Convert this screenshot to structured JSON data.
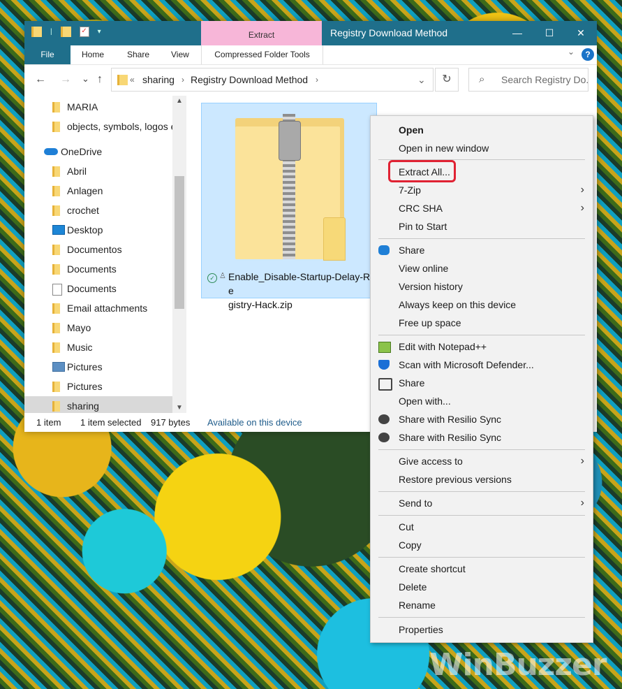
{
  "window": {
    "title": "Registry Download Method",
    "context_tab_top": "Extract",
    "controls": {
      "minimize": "—",
      "maximize": "☐",
      "close": "✕"
    }
  },
  "ribbon": {
    "tabs": [
      "File",
      "Home",
      "Share",
      "View"
    ],
    "context_tab": "Compressed Folder Tools",
    "help": "?"
  },
  "nav": {
    "back": "←",
    "forward": "→",
    "recent": "⌄",
    "up": "↑"
  },
  "address": {
    "overflow": "«",
    "crumbs": [
      "sharing",
      "Registry Download Method"
    ],
    "sep": "›",
    "dropdown": "⌄",
    "refresh": "↻"
  },
  "search": {
    "placeholder": "Search Registry Do...",
    "icon": "⌕"
  },
  "navpane": {
    "items": [
      {
        "label": "MARIA",
        "icon": "folder-icon"
      },
      {
        "label": "objects, symbols, logos e",
        "icon": "folder-icon"
      },
      {
        "label": "OneDrive",
        "icon": "onedrive-cloud-icon"
      },
      {
        "label": "Abril",
        "icon": "folder-icon"
      },
      {
        "label": "Anlagen",
        "icon": "folder-icon"
      },
      {
        "label": "crochet",
        "icon": "folder-icon"
      },
      {
        "label": "Desktop",
        "icon": "desktop-icon"
      },
      {
        "label": "Documentos",
        "icon": "folder-icon"
      },
      {
        "label": "Documents",
        "icon": "folder-icon"
      },
      {
        "label": "Documents",
        "icon": "document-icon"
      },
      {
        "label": "Email attachments",
        "icon": "folder-icon"
      },
      {
        "label": "Mayo",
        "icon": "folder-icon"
      },
      {
        "label": "Music",
        "icon": "folder-icon"
      },
      {
        "label": "Pictures",
        "icon": "pictures-icon"
      },
      {
        "label": "Pictures",
        "icon": "folder-icon"
      },
      {
        "label": "sharing",
        "icon": "folder-icon",
        "selected": true
      }
    ]
  },
  "file": {
    "name": "Enable_Disable-Startup-Delay-Registry-Hack.zip",
    "name_line1": "Enable_Disable-Startup-Delay-Re",
    "name_line2": "gistry-Hack.zip",
    "sync_status": "✓",
    "person": "♙"
  },
  "statusbar": {
    "count": "1 item",
    "selected": "1 item selected",
    "size": "917 bytes",
    "availability": "Available on this device"
  },
  "context_menu": {
    "items": [
      {
        "label": "Open",
        "bold": true
      },
      {
        "label": "Open in new window"
      },
      {
        "label": "Extract All..."
      },
      {
        "label": "7-Zip",
        "submenu": true
      },
      {
        "label": "CRC SHA",
        "submenu": true
      },
      {
        "label": "Pin to Start"
      },
      {
        "label": "Share",
        "icon": "onedrive-cloud-icon"
      },
      {
        "label": "View online"
      },
      {
        "label": "Version history"
      },
      {
        "label": "Always keep on this device"
      },
      {
        "label": "Free up space"
      },
      {
        "label": "Edit with Notepad++",
        "icon": "notepadpp-icon"
      },
      {
        "label": "Scan with Microsoft Defender...",
        "icon": "defender-shield-icon"
      },
      {
        "label": "Share",
        "icon": "share-icon"
      },
      {
        "label": "Open with..."
      },
      {
        "label": "Share with Resilio Sync",
        "icon": "resilio-icon"
      },
      {
        "label": "Share with Resilio Sync",
        "icon": "resilio-icon"
      },
      {
        "label": "Give access to",
        "submenu": true
      },
      {
        "label": "Restore previous versions"
      },
      {
        "label": "Send to",
        "submenu": true
      },
      {
        "label": "Cut"
      },
      {
        "label": "Copy"
      },
      {
        "label": "Create shortcut"
      },
      {
        "label": "Delete"
      },
      {
        "label": "Rename"
      },
      {
        "label": "Properties"
      }
    ],
    "arrow": "›"
  },
  "watermark": "WinBuzzer",
  "colors": {
    "titlebar": "#1f6f8b",
    "selection": "#cce8ff",
    "highlight": "#e02233",
    "status_text": "#1f5c8b"
  }
}
